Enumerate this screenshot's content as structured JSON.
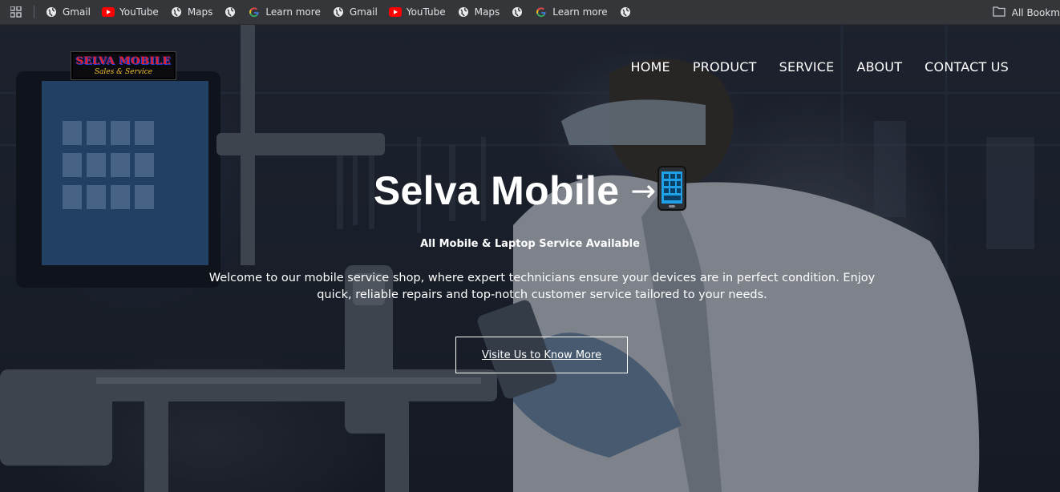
{
  "bookmarks_bar": {
    "items": [
      {
        "label": "Gmail",
        "icon": "globe-icon"
      },
      {
        "label": "YouTube",
        "icon": "youtube-icon"
      },
      {
        "label": "Maps",
        "icon": "globe-icon"
      },
      {
        "label": "",
        "icon": "globe-icon"
      },
      {
        "label": "Learn more",
        "icon": "google-icon"
      },
      {
        "label": "Gmail",
        "icon": "globe-icon"
      },
      {
        "label": "YouTube",
        "icon": "youtube-icon"
      },
      {
        "label": "Maps",
        "icon": "globe-icon"
      },
      {
        "label": "",
        "icon": "globe-icon"
      },
      {
        "label": "Learn more",
        "icon": "google-icon"
      },
      {
        "label": "",
        "icon": "globe-icon"
      }
    ],
    "all_bookmarks_label": "All Bookm"
  },
  "logo": {
    "title": "SELVA MOBILE",
    "subtitle": "Sales & Service"
  },
  "nav": {
    "items": [
      "HOME",
      "PRODUCT",
      "SERVICE",
      "ABOUT",
      "CONTACT US"
    ]
  },
  "hero": {
    "title": "Selva Mobile",
    "arrow": "→",
    "tagline": "All Mobile & Laptop Service Available",
    "intro": "Welcome to our mobile service shop, where expert technicians ensure your devices are in perfect condition. Enjoy quick, reliable repairs and top-notch customer service tailored to your needs.",
    "cta_label": "Visite Us to Know More"
  },
  "colors": {
    "bookmarks_bg": "#35363a",
    "hero_text": "#ffffff",
    "logo_red": "#e2202a",
    "logo_blue": "#1e3fd8",
    "logo_gold": "#f2c230",
    "phone_screen": "#1fa0e8"
  }
}
